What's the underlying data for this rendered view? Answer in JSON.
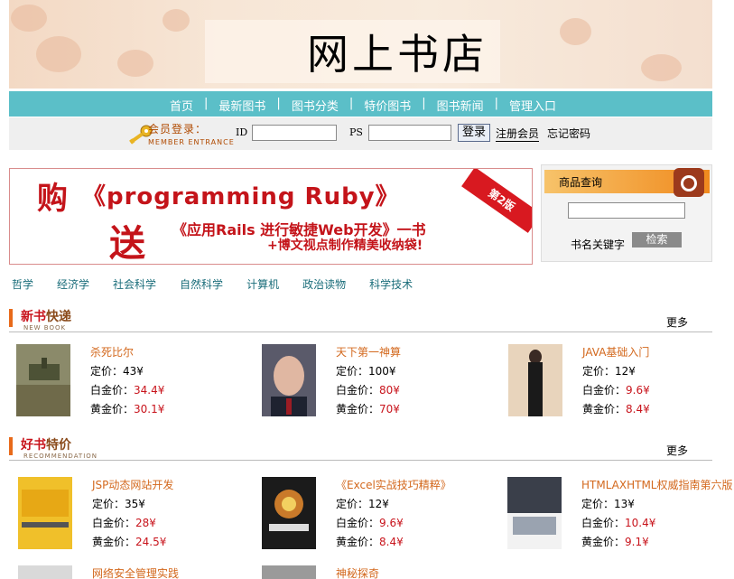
{
  "site": {
    "title": "网上书店"
  },
  "nav": {
    "items": [
      "首页",
      "最新图书",
      "图书分类",
      "特价图书",
      "图书新闻",
      "管理入口"
    ],
    "separator": "|"
  },
  "login": {
    "member_cn": "会员登录：",
    "member_en": "MEMBER ENTRANCE",
    "id_label": "ID",
    "ps_label": "PS",
    "login_button": "登录",
    "register_link": "注册会员",
    "forgot_link": "忘记密码"
  },
  "promo": {
    "buy": "购",
    "book_title": "《programming Ruby》",
    "edition": "第2版",
    "send": "送",
    "gift_line1": "《应用Rails 进行敏捷Web开发》一书",
    "gift_line2": "+博文视点制作精美收纳袋!"
  },
  "search": {
    "header": "商品查询",
    "keyword_label": "书名关键字",
    "button": "检索"
  },
  "categories": [
    "哲学",
    "经济学",
    "社会科学",
    "自然科学",
    "计算机",
    "政治读物",
    "科学技术"
  ],
  "new_books": {
    "title_a": "新书",
    "title_b": "快递",
    "subtitle": "NEW BOOK",
    "more": "更多",
    "items": [
      {
        "name": "杀死比尔",
        "price_label": "定价：",
        "price": "43¥",
        "gold_label": "白金价：",
        "gold": "34.4¥",
        "plat_label": "黄金价：",
        "plat": "30.1¥"
      },
      {
        "name": "天下第一神算",
        "price_label": "定价：",
        "price": "100¥",
        "gold_label": "白金价：",
        "gold": "80¥",
        "plat_label": "黄金价：",
        "plat": "70¥"
      },
      {
        "name": "JAVA基础入门",
        "price_label": "定价：",
        "price": "12¥",
        "gold_label": "白金价：",
        "gold": "9.6¥",
        "plat_label": "黄金价：",
        "plat": "8.4¥"
      }
    ]
  },
  "special_books": {
    "title_a": "好书",
    "title_b": "特价",
    "subtitle": "RECOMMENDATION",
    "more": "更多",
    "items": [
      {
        "name": "JSP动态网站开发",
        "price_label": "定价：",
        "price": "35¥",
        "gold_label": "白金价：",
        "gold": "28¥",
        "plat_label": "黄金价：",
        "plat": "24.5¥"
      },
      {
        "name": "《Excel实战技巧精粹》",
        "price_label": "定价：",
        "price": "12¥",
        "gold_label": "白金价：",
        "gold": "9.6¥",
        "plat_label": "黄金价：",
        "plat": "8.4¥"
      },
      {
        "name": "HTMLAXHTML权威指南第六版",
        "price_label": "定价：",
        "price": "13¥",
        "gold_label": "白金价：",
        "gold": "10.4¥",
        "plat_label": "黄金价：",
        "plat": "9.1¥"
      }
    ],
    "partial": [
      "网络安全管理实践",
      "神秘探奇"
    ]
  },
  "colors": {
    "nav": "#5bbfc8",
    "accent_red": "#c8141c",
    "book_title": "#d3681d",
    "category": "#1a6d7a"
  }
}
